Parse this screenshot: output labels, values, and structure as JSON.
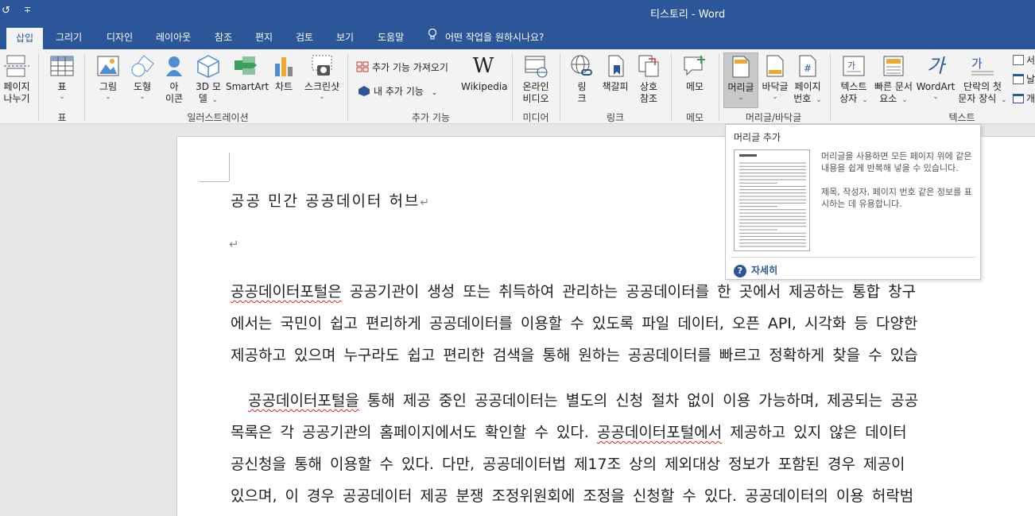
{
  "titlebar": {
    "undo_glyph": "↺",
    "customize_glyph": "∓",
    "title": "티스토리  -  Word"
  },
  "tabs": [
    {
      "label": "삽입",
      "active": true
    },
    {
      "label": "그리기"
    },
    {
      "label": "디자인"
    },
    {
      "label": "레이아웃"
    },
    {
      "label": "참조"
    },
    {
      "label": "편지"
    },
    {
      "label": "검토"
    },
    {
      "label": "보기"
    },
    {
      "label": "도움말"
    }
  ],
  "tell_me": "어떤 작업을 원하시나요?",
  "ribbon": {
    "page_break": {
      "line1": "페이지",
      "line2": "나누기"
    },
    "table": {
      "label": "표",
      "group": "표"
    },
    "illustrations": {
      "group": "일러스트레이션",
      "picture": "그림",
      "shapes": "도형",
      "icons": {
        "line1": "아",
        "line2": "이콘"
      },
      "model3d": {
        "line1": "3D 모",
        "line2": "델"
      },
      "smartart": "SmartArt",
      "chart": "차트",
      "screenshot": "스크린샷"
    },
    "addins": {
      "group": "추가 기능",
      "get": "추가 기능 가져오기",
      "mine": "내 추가 기능",
      "wikipedia": "Wikipedia"
    },
    "media": {
      "group": "미디어",
      "line1": "온라인",
      "line2": "비디오"
    },
    "links": {
      "group": "링크",
      "link": {
        "line1": "링",
        "line2": "크"
      },
      "bookmark": "책갈피",
      "crossref": {
        "line1": "상호",
        "line2": "참조"
      }
    },
    "comments": {
      "group": "메모",
      "label": "메모"
    },
    "header_footer": {
      "group": "머리글/바닥글",
      "header": "머리글",
      "footer": "바닥글",
      "page_number": {
        "line1": "페이지",
        "line2": "번호"
      }
    },
    "text": {
      "group": "텍스트",
      "textbox": {
        "line1": "텍스트",
        "line2": "상자"
      },
      "quickparts": {
        "line1": "빠른 문서",
        "line2": "요소"
      },
      "wordart": "WordArt",
      "dropcap": {
        "line1": "단락의 첫",
        "line2": "문자 장식"
      },
      "cut1": "서",
      "cut2": "날",
      "cut3": "개"
    }
  },
  "document": {
    "title": "공공 민간 공공데이터 허브",
    "para_mark": "↵",
    "p1": [
      {
        "spell": "공공데이터포털은",
        "rest": " 공공기관이 생성 또는 취득하여 관리하는 공공데이터를 한 곳에서 제공하는 통합 창구"
      },
      {
        "rest": "에서는 국민이 쉽고 편리하게 공공데이터를 이용할 수 있도록 파일 데이터, 오픈 API, 시각화 등 다양한"
      },
      {
        "rest": "제공하고 있으며 누구라도 쉽고 편리한 검색을 통해 원하는 공공데이터를 빠르고 정확하게 찾을 수 있습"
      }
    ],
    "p2": [
      {
        "prefix": "  ",
        "spell": "공공데이터포털을",
        "rest": " 통해 제공 중인 공공데이터는 별도의 신청 절차 없이 이용 가능하며, 제공되는 공공"
      },
      {
        "pre": "목록은 각 공공기관의 홈페이지에서도 확인할 수 있다. ",
        "spell": "공공데이터포털에서",
        "rest": " 제공하고 있지 않은 데이터"
      },
      {
        "rest": "공신청을 통해 이용할 수 있다. 다만, 공공데이터법 제17조 상의 제외대상 정보가 포함된 경우 제공이"
      },
      {
        "rest": "있으며, 이 경우 공공데이터 제공 분쟁 조정위원회에 조정을 신청할 수 있다. 공공데이터의 이용 허락범"
      }
    ]
  },
  "tooltip": {
    "title": "머리글 추가",
    "desc1": "머리글을 사용하면 모든 페이지 위에 같은 내용을 쉽게 반복해 넣을 수 있습니다.",
    "desc2": "제목, 작성자, 페이지 번호 같은 정보를 표시하는 데 유용합니다.",
    "more": "자세히",
    "more_glyph": "?"
  },
  "colors": {
    "accent": "#2b579a",
    "ribbon_bg": "#f3f3f3",
    "doc_bg": "#e6e6e6"
  }
}
